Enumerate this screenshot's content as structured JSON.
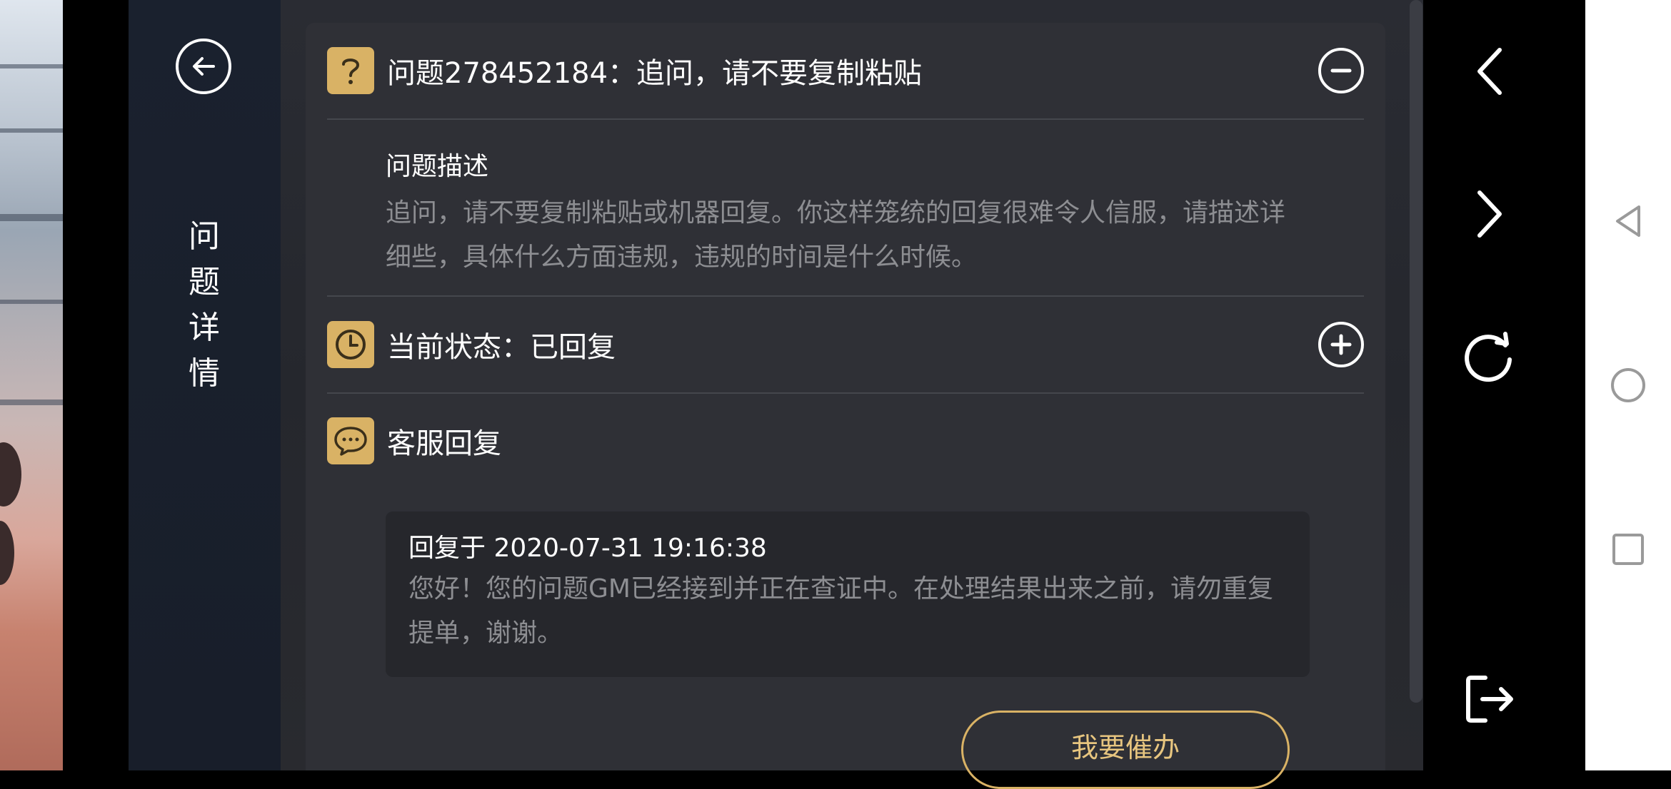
{
  "sidebar": {
    "title_chars": [
      "问",
      "题",
      "详",
      "情"
    ],
    "back_icon": "arrow-left-circle-icon"
  },
  "question": {
    "title": "问题278452184：追问，请不要复制粘贴",
    "icon": "question-mark-icon",
    "toggle_icon": "minus-circle-icon",
    "description_label": "问题描述",
    "description_text": "追问，请不要复制粘贴或机器回复。你这样笼统的回复很难令人信服，请描述详细些，具体什么方面违规，违规的时间是什么时候。"
  },
  "status": {
    "title": "当前状态：已回复",
    "icon": "clock-icon",
    "toggle_icon": "plus-circle-icon"
  },
  "reply": {
    "title": "客服回复",
    "icon": "chat-bubble-icon",
    "time": "回复于 2020-07-31 19:16:38",
    "text": "您好！您的问题GM已经接到并正在查证中。在处理结果出来之前，请勿重复提单，谢谢。"
  },
  "urge_button": {
    "label": "我要催办"
  },
  "right_nav": {
    "items": [
      "chevron-left-icon",
      "chevron-right-icon",
      "refresh-icon",
      "exit-icon"
    ]
  },
  "system_nav": {
    "items": [
      "back-triangle-icon",
      "home-circle-icon",
      "recents-square-icon"
    ]
  },
  "colors": {
    "accent": "#d9b265",
    "text_primary": "#ffffff",
    "text_secondary": "#8d8e92"
  }
}
